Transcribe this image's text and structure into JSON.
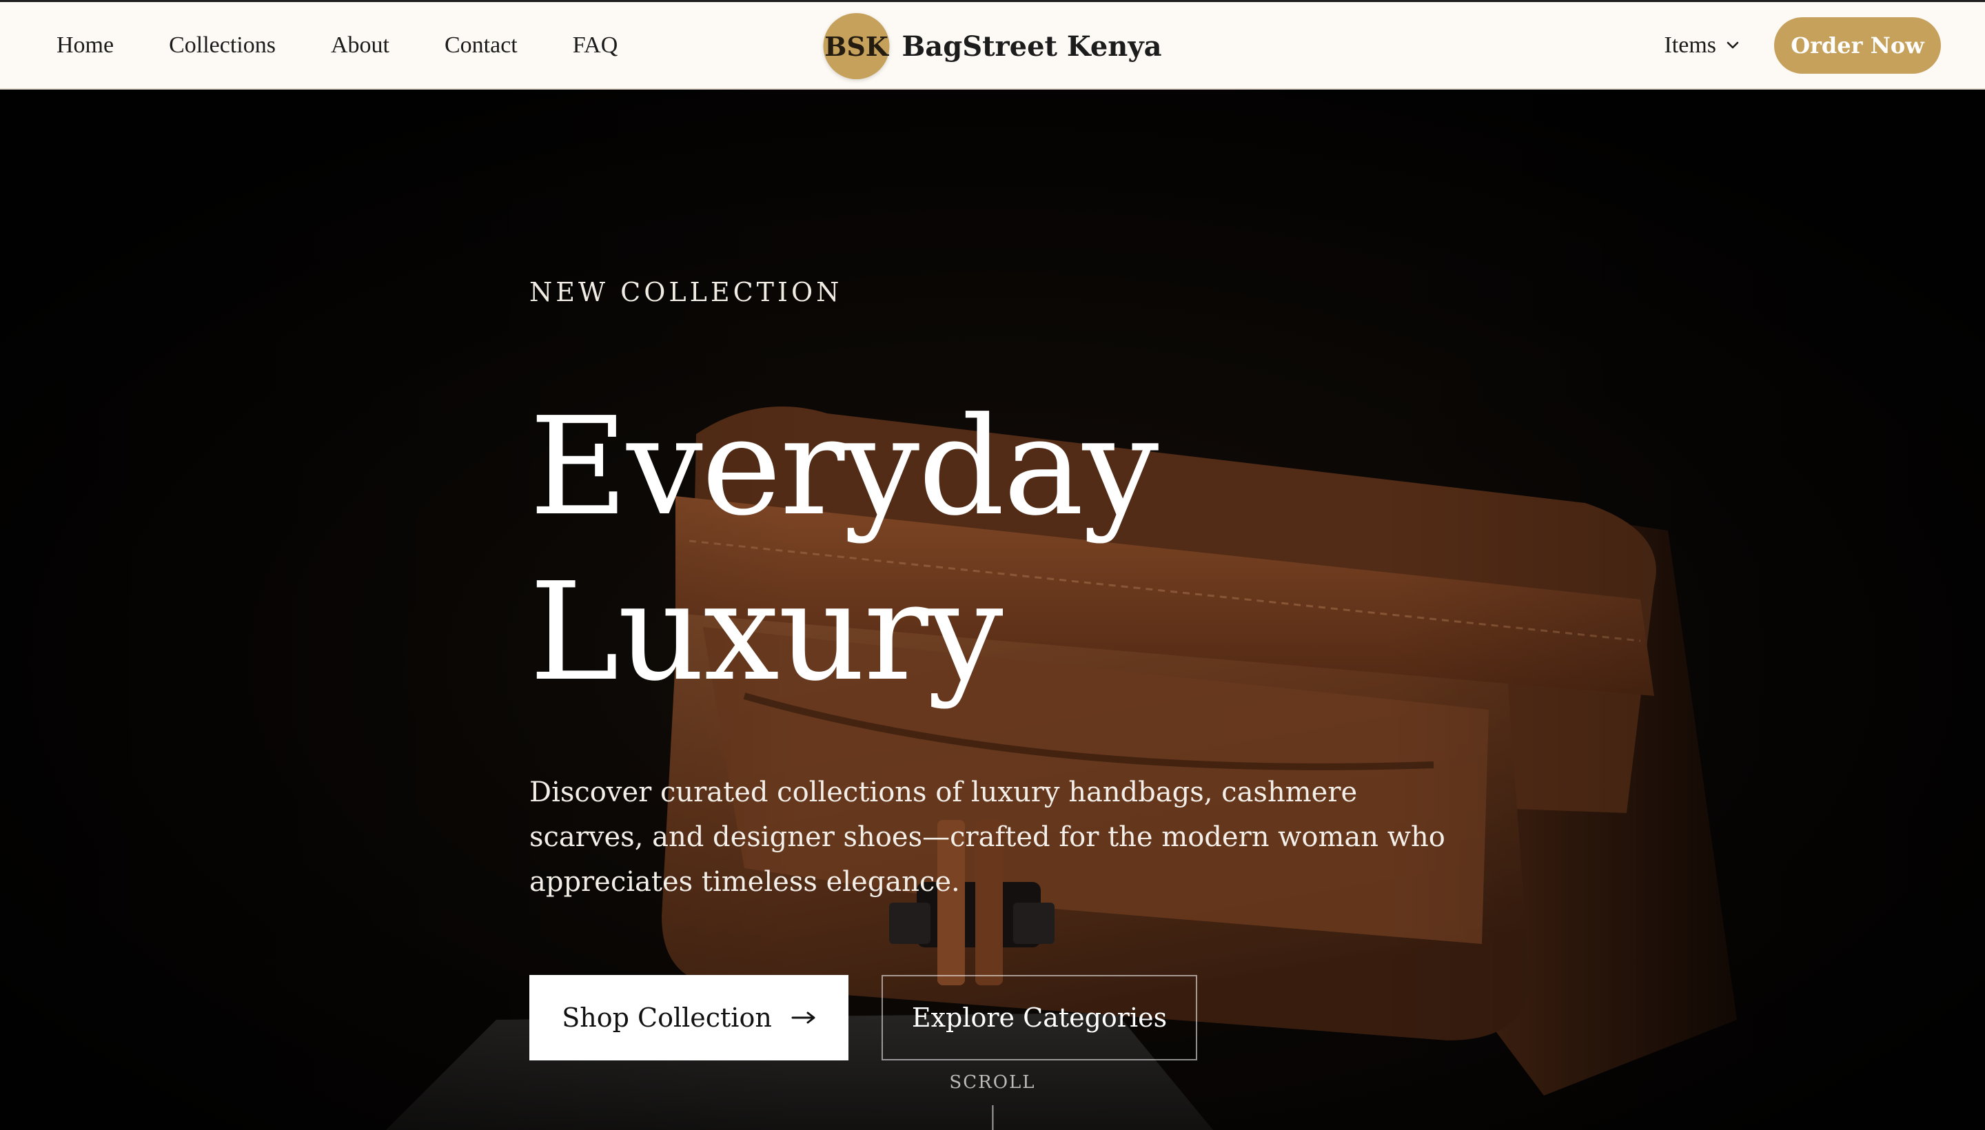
{
  "nav": {
    "links": [
      "Home",
      "Collections",
      "About",
      "Contact",
      "FAQ"
    ],
    "brand_badge": "BSK",
    "brand_name": "BagStreet Kenya",
    "items_label": "Items",
    "order_label": "Order Now"
  },
  "hero": {
    "eyebrow": "NEW COLLECTION",
    "headline_line1": "Everyday",
    "headline_line2": "Luxury",
    "description": "Discover curated collections of luxury handbags, cashmere scarves, and designer shoes—crafted for the modern woman who appreciates timeless elegance.",
    "shop_label": "Shop Collection",
    "explore_label": "Explore Categories",
    "scroll_label": "SCROLL"
  },
  "colors": {
    "accent": "#c6a15b",
    "nav_background": "#fdf9f4",
    "hero_text": "#ffffff"
  },
  "icons": {
    "chevron": "chevron-down-icon",
    "arrow": "arrow-right-icon"
  }
}
